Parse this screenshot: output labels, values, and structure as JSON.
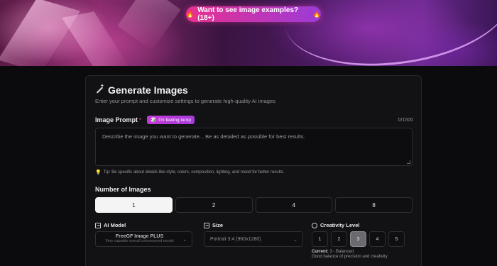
{
  "hero": {
    "examples_pill": "Want to see image examples? (18+)",
    "fire_icon": "fire-icon"
  },
  "card": {
    "title": "Generate Images",
    "subtitle": "Enter your prompt and customize settings to generate high-quality AI images"
  },
  "prompt": {
    "label": "Image Prompt",
    "required_mark": "*",
    "lucky_button": "I'm feeling lucky",
    "counter": "0/1500",
    "placeholder": "Describe the image you want to generate... Be as detailed as possible for best results.",
    "tip": "Tip: Be specific about details like style, colors, composition, lighting, and mood for better results."
  },
  "number_of_images": {
    "label": "Number of Images",
    "options": [
      "1",
      "2",
      "4",
      "8"
    ],
    "selected": "1"
  },
  "ai_model": {
    "label": "AI Model",
    "name": "FreeGF Image PLUS",
    "description": "Very capable overall uncensored model"
  },
  "size": {
    "label": "Size",
    "selected": "Portrait 3:4 (960x1280)"
  },
  "creativity": {
    "label": "Creativity Level",
    "options": [
      "1",
      "2",
      "3",
      "4",
      "5"
    ],
    "selected": "3",
    "current_label": "Current:",
    "current_value": "3 - Balanced",
    "description": "Good balance of precision and creativity"
  }
}
